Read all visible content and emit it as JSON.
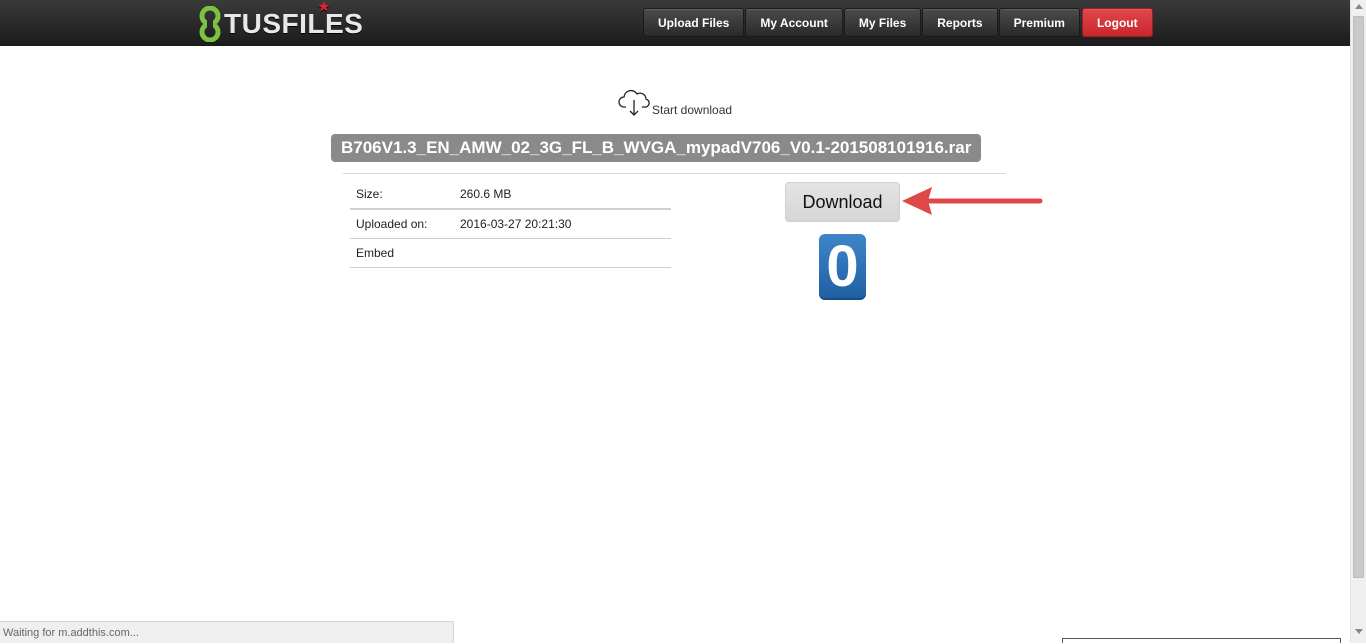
{
  "header": {
    "logo_text": "TUSFILES",
    "nav": [
      {
        "label": "Upload Files"
      },
      {
        "label": "My Account"
      },
      {
        "label": "My Files"
      },
      {
        "label": "Reports"
      },
      {
        "label": "Premium"
      },
      {
        "label": "Logout"
      }
    ],
    "logout_color": "#d6353b"
  },
  "main": {
    "start_download_label": "Start download",
    "filename": "B706V1.3_EN_AMW_02_3G_FL_B_WVGA_mypadV706_V0.1-201508101916.rar",
    "info": [
      {
        "label": "Size:",
        "value": "260.6 MB"
      },
      {
        "label": "Uploaded on:",
        "value": "2016-03-27 20:21:30"
      },
      {
        "label": "Embed",
        "value": ""
      }
    ],
    "download_button_label": "Download",
    "countdown": "0",
    "countdown_color": "#2a6fb5",
    "arrow_color": "#e04848"
  },
  "status_bar": {
    "text": "Waiting for m.addthis.com..."
  },
  "icons": {
    "start_download": "cloud-download-icon",
    "logo": "tusfiles-logo-icon",
    "arrow": "red-arrow-icon"
  }
}
